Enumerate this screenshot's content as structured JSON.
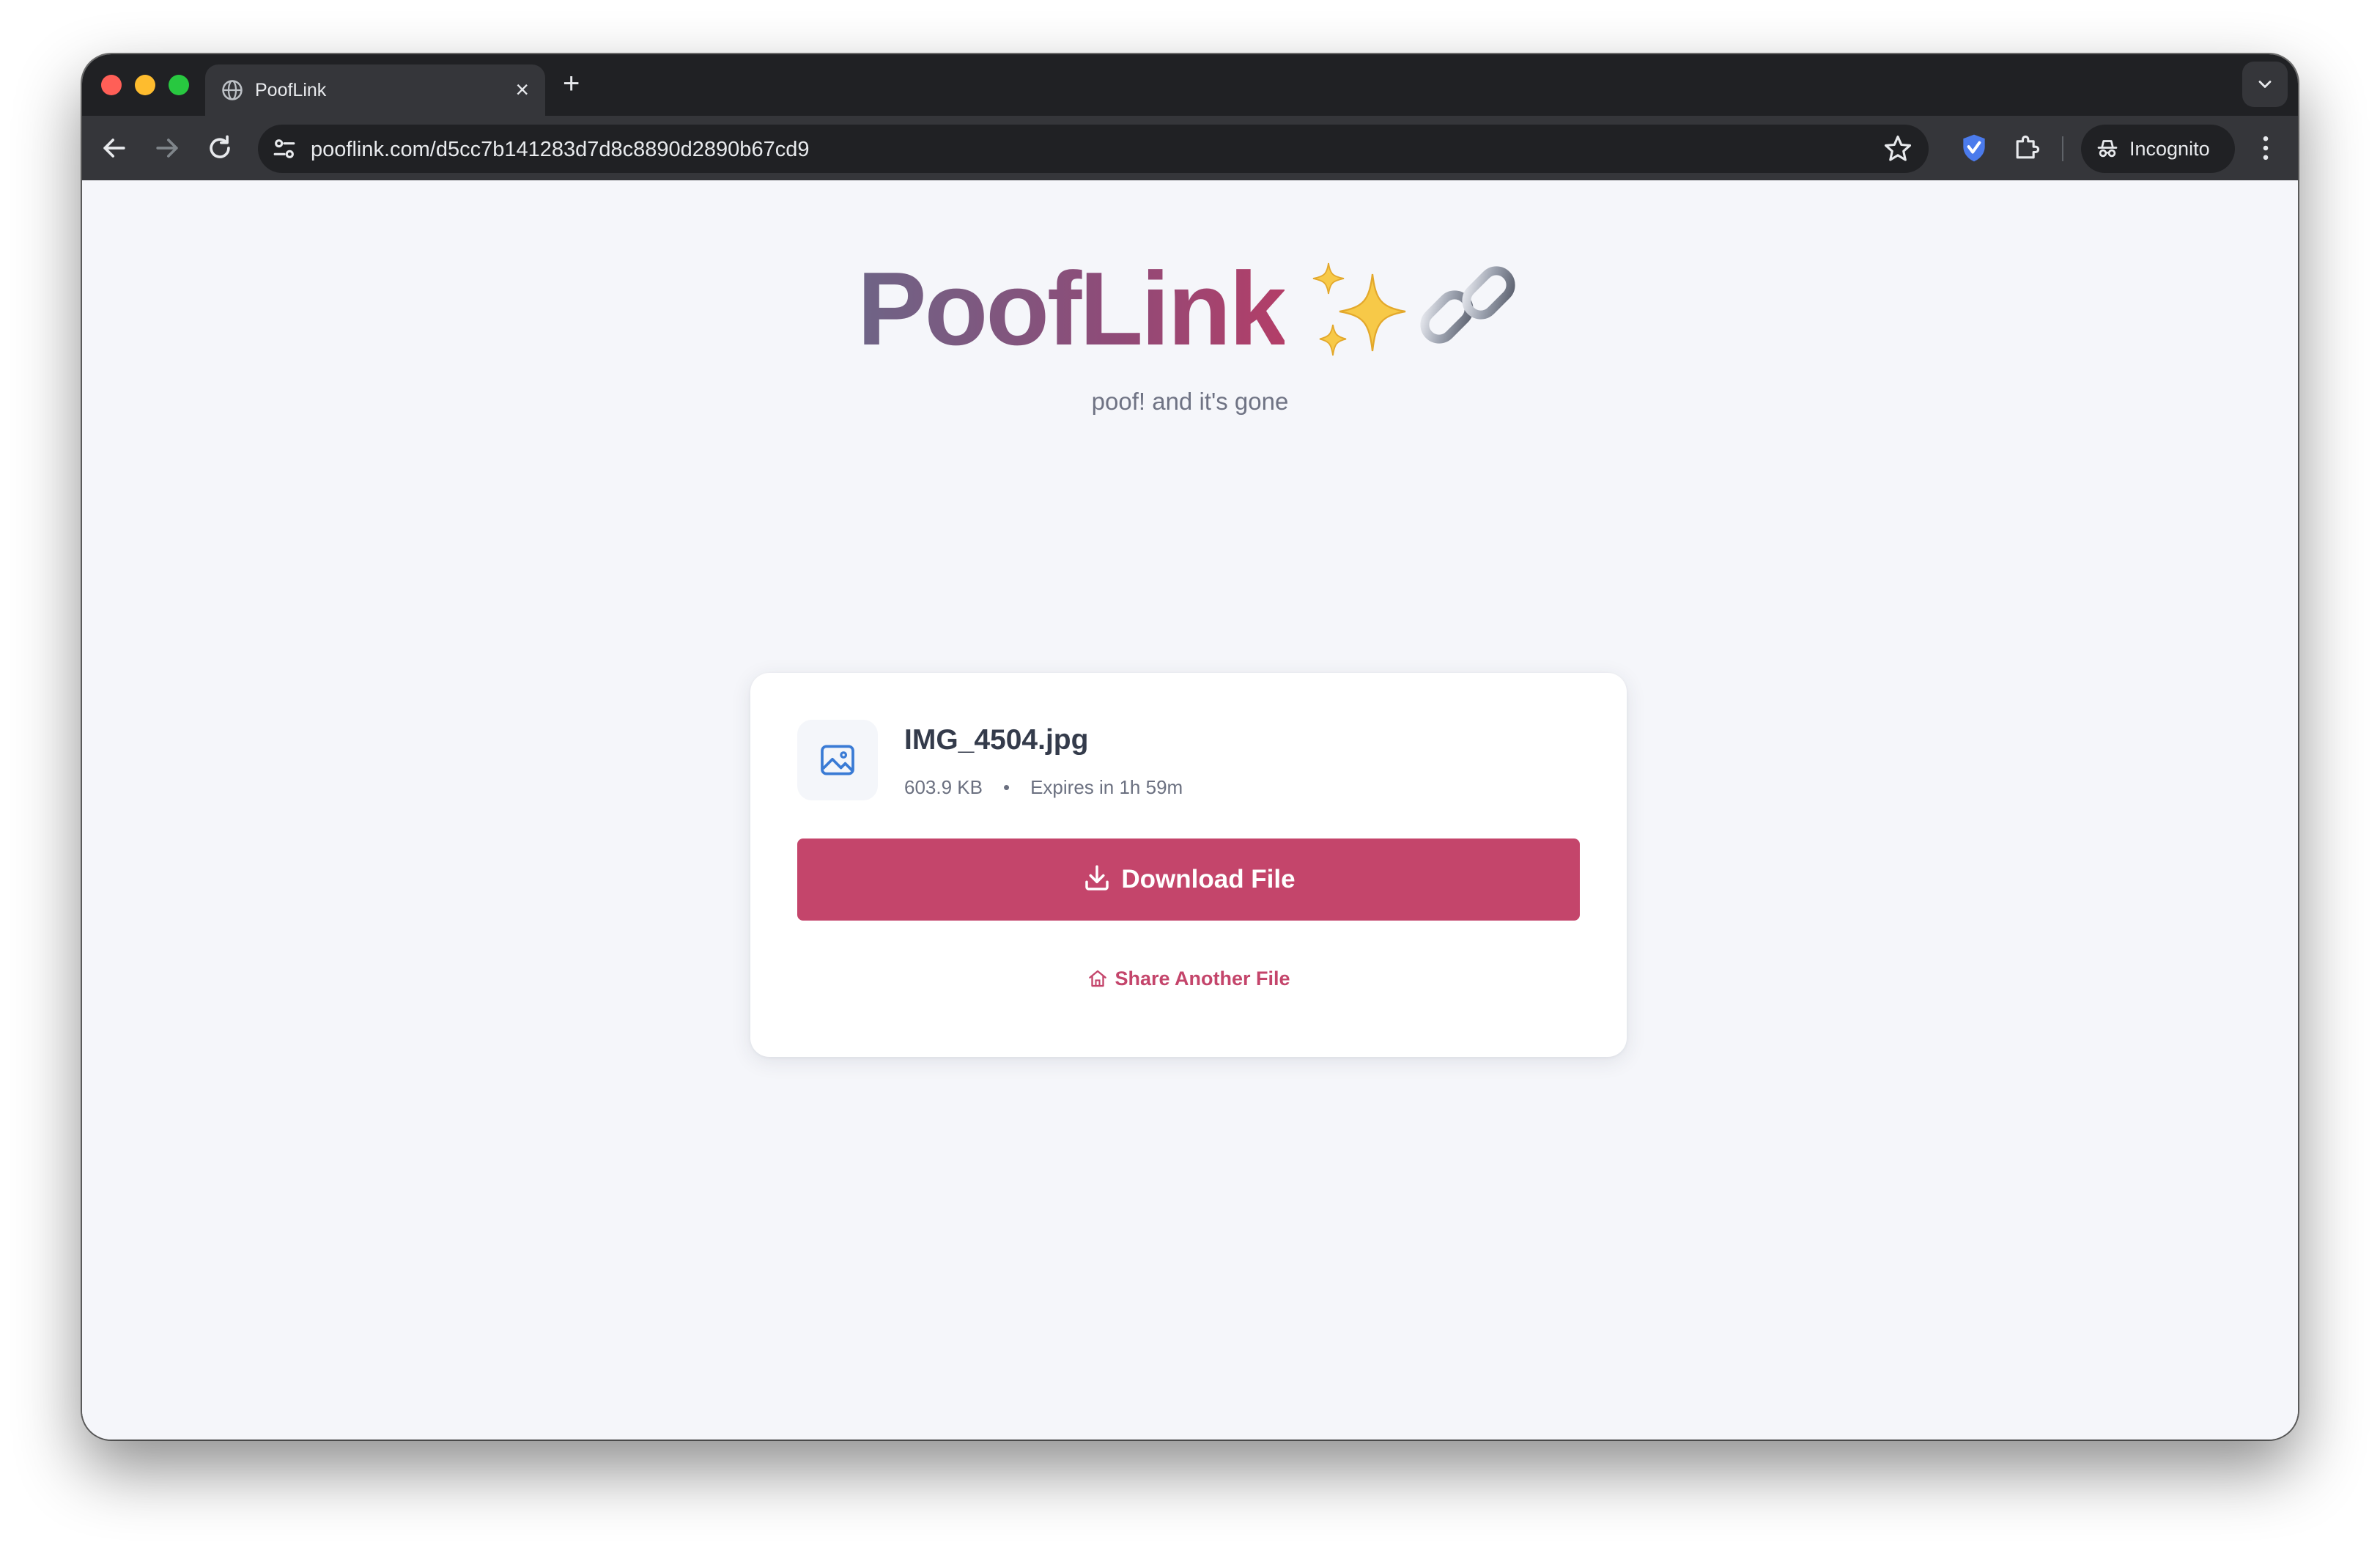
{
  "browser": {
    "tab": {
      "title": "PoofLink",
      "close_icon": "×"
    },
    "new_tab_icon": "+",
    "address_bar": {
      "url": "pooflink.com/d5cc7b141283d7d8c8890d2890b67cd9"
    },
    "profile": {
      "label": "Incognito"
    }
  },
  "hero": {
    "logo_text": "PoofLink",
    "logo_emoji": [
      "sparkles-emoji",
      "link-emoji"
    ],
    "tagline": "poof! and it's gone"
  },
  "file": {
    "icon": "image-icon",
    "name": "IMG_4504.jpg",
    "size": "603.9 KB",
    "separator": "•",
    "expires": "Expires in 1h 59m"
  },
  "actions": {
    "download_label": "Download File",
    "share_another_label": "Share Another File"
  },
  "colors": {
    "accent": "#c4456b",
    "page_background": "#f5f6fa",
    "browser_frame": "#202124",
    "browser_toolbar": "#35363a"
  }
}
